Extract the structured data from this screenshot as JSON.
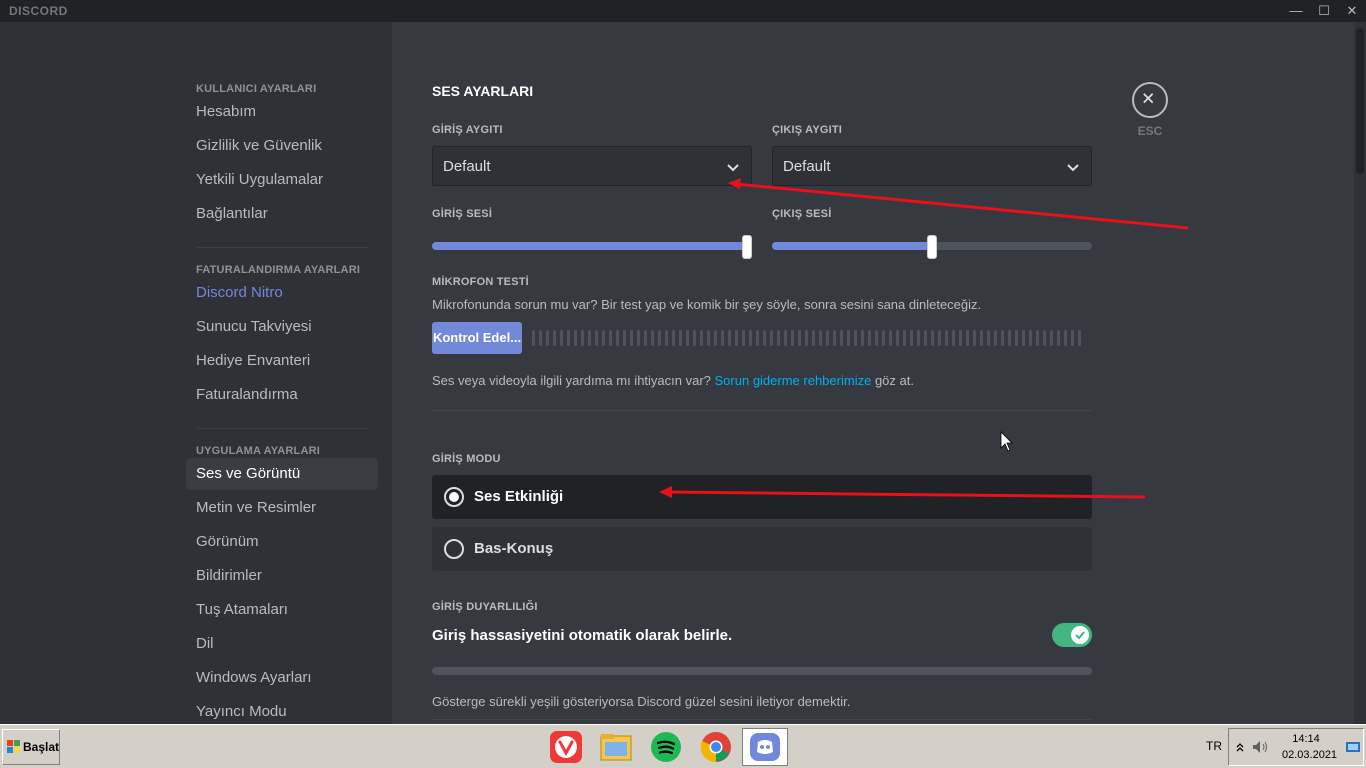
{
  "window": {
    "brand": "DISCORD"
  },
  "sidebar": {
    "sections": [
      {
        "header": "KULLANICI AYARLARI",
        "items": [
          "Hesabım",
          "Gizlilik ve Güvenlik",
          "Yetkili Uygulamalar",
          "Bağlantılar"
        ]
      },
      {
        "header": "FATURALANDIRMA AYARLARI",
        "items": [
          "Discord Nitro",
          "Sunucu Takviyesi",
          "Hediye Envanteri",
          "Faturalandırma"
        ]
      },
      {
        "header": "UYGULAMA AYARLARI",
        "items": [
          "Ses ve Görüntü",
          "Metin ve Resimler",
          "Görünüm",
          "Bildirimler",
          "Tuş Atamaları",
          "Dil",
          "Windows Ayarları",
          "Yayıncı Modu"
        ]
      }
    ],
    "active_item": "Ses ve Görüntü"
  },
  "voice": {
    "title": "SES AYARLARI",
    "input_device_label": "GİRİŞ AYGITI",
    "input_device_value": "Default",
    "output_device_label": "ÇIKIŞ AYGITI",
    "output_device_value": "Default",
    "input_volume_label": "GİRİŞ SESİ",
    "input_volume": 0.985,
    "output_volume_label": "ÇIKIŞ SESİ",
    "output_volume": 0.5,
    "mic_test_label": "MİKROFON TESTİ",
    "mic_test_desc": "Mikrofonunda sorun mu var? Bir test yap ve komik bir şey söyle, sonra sesini sana dinleteceğiz.",
    "mic_test_button": "Kontrol Edel...",
    "help_text_pre": "Ses veya videoyla ilgili yardıma mı ihtiyacın var?",
    "help_link": "Sorun giderme rehberimize",
    "help_text_post": "göz at.",
    "input_mode_label": "GİRİŞ MODU",
    "mode_voice_activity": "Ses Etkinliği",
    "mode_push_to_talk": "Bas-Konuş",
    "selected_mode": "Ses Etkinliği",
    "sensitivity_label": "GİRİŞ DUYARLILIĞI",
    "auto_sensitivity": "Giriş hassasiyetini otomatik olarak belirle.",
    "auto_sensitivity_on": true,
    "sensitivity_desc": "Gösterge sürekli yeşili gösteriyorsa Discord güzel sesini iletiyor demektir."
  },
  "close": {
    "label": "ESC"
  },
  "taskbar": {
    "start_label": "Başlat",
    "apps": [
      "vivaldi-icon",
      "file-explorer-icon",
      "spotify-icon",
      "chrome-icon",
      "discord-icon"
    ],
    "language": "TR",
    "time": "14:14",
    "date": "02.03.2021"
  },
  "colors": {
    "accent": "#7289da",
    "link": "#00b0f4",
    "toggle_on": "#43b581",
    "annotation": "#e8101a"
  }
}
